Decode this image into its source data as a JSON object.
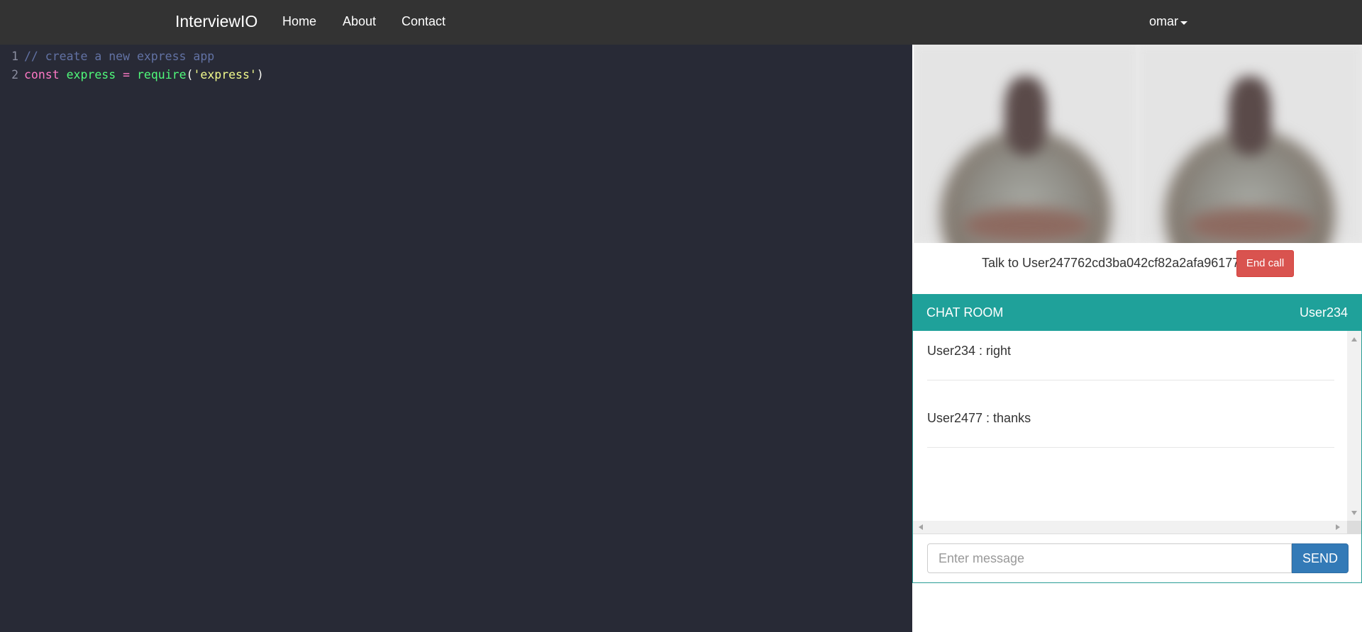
{
  "navbar": {
    "brand": "InterviewIO",
    "links": [
      {
        "label": "Home"
      },
      {
        "label": "About"
      },
      {
        "label": "Contact"
      }
    ],
    "user": "omar"
  },
  "editor": {
    "theme_colors": {
      "background": "#282a36",
      "comment": "#6272a4",
      "keyword": "#ff79c6",
      "variable": "#50fa7b",
      "string": "#f1fa8c"
    },
    "lines": [
      {
        "number": "1",
        "comment": "// create a new express app"
      },
      {
        "number": "2",
        "keyword": "const",
        "variable": "express",
        "operator": "=",
        "function": "require",
        "open_paren": "(",
        "string": "'express'",
        "close_paren": ")"
      }
    ]
  },
  "call": {
    "talk_label": "Talk to User247762cd3ba042cf82a2afa96177",
    "end_call_label": "End call",
    "end_call_color": "#d9534f"
  },
  "chat": {
    "title": "CHAT ROOM",
    "current_user": "User234",
    "header_color": "#1fa19a",
    "messages": [
      {
        "text": "User234 : right"
      },
      {
        "text": "User2477 : thanks"
      }
    ],
    "input_placeholder": "Enter message",
    "send_label": "SEND",
    "send_color": "#337ab7"
  }
}
